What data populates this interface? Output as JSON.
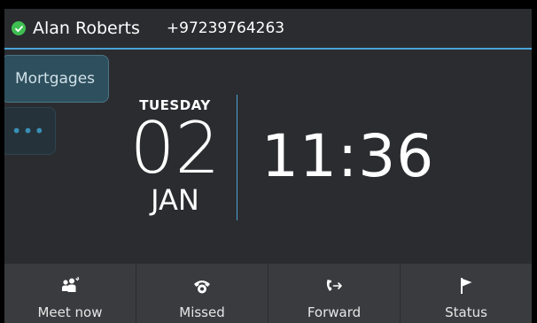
{
  "header": {
    "user_name": "Alan Roberts",
    "phone_number": "+97239764263",
    "presence_icon": "check-circle-icon",
    "presence_color": "#3fbf52",
    "accent_color": "#4aa3d6"
  },
  "line_keys": [
    {
      "label": "Mortgages"
    },
    {
      "label": "•••"
    }
  ],
  "clock": {
    "weekday": "TUESDAY",
    "day": "02",
    "month": "JAN",
    "time": "11:36"
  },
  "softkeys": [
    {
      "label": "Meet now",
      "icon": "meet-now-icon"
    },
    {
      "label": "Missed",
      "icon": "missed-call-icon"
    },
    {
      "label": "Forward",
      "icon": "forward-call-icon"
    },
    {
      "label": "Status",
      "icon": "flag-icon"
    }
  ]
}
